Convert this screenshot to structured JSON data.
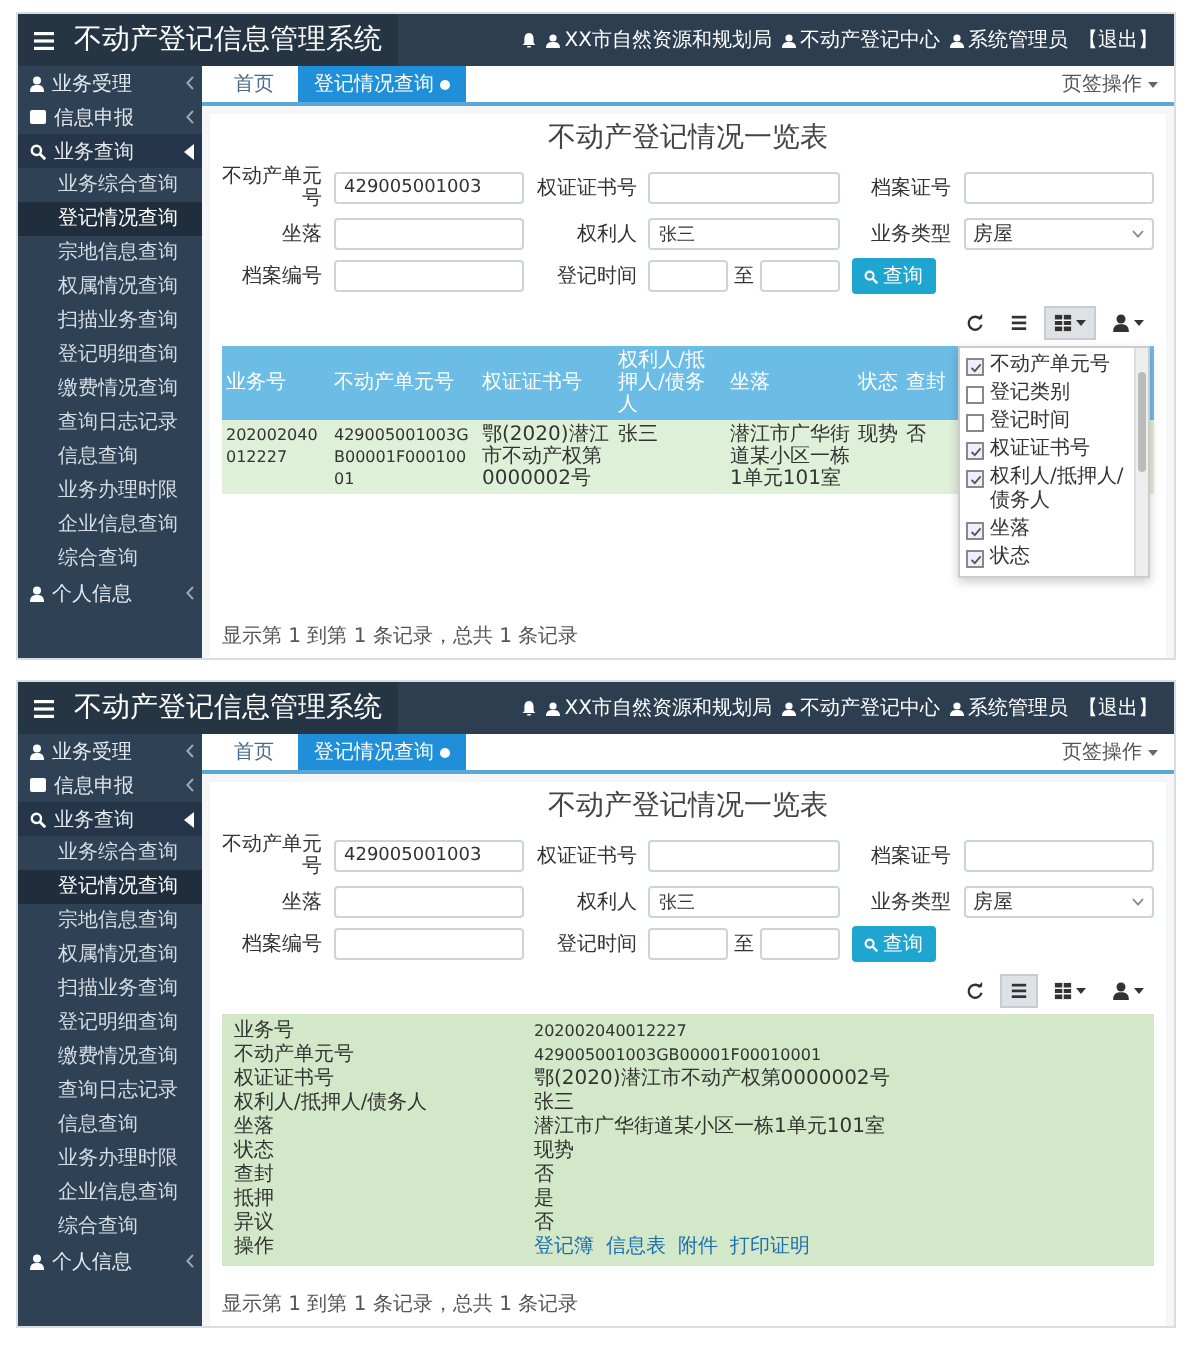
{
  "screens": [
    {
      "app_title": "不动产登记信息管理系统",
      "header_links": [
        {
          "kind": "user",
          "label": "XX市自然资源和规划局"
        },
        {
          "kind": "user",
          "label": "不动产登记中心"
        },
        {
          "kind": "user",
          "label": "系统管理员"
        },
        {
          "kind": "plain",
          "label": "【退出】"
        }
      ],
      "sidebar": [
        {
          "kind": "user",
          "label": "业务受理",
          "expanded": false
        },
        {
          "kind": "card",
          "label": "信息申报",
          "expanded": false
        },
        {
          "kind": "search",
          "label": "业务查询",
          "expanded": true,
          "children": [
            {
              "label": "业务综合查询",
              "selected": false
            },
            {
              "label": "登记情况查询",
              "selected": true
            },
            {
              "label": "宗地信息查询",
              "selected": false
            },
            {
              "label": "权属情况查询",
              "selected": false
            },
            {
              "label": "扫描业务查询",
              "selected": false
            },
            {
              "label": "登记明细查询",
              "selected": false
            },
            {
              "label": "缴费情况查询",
              "selected": false
            },
            {
              "label": "查询日志记录",
              "selected": false
            },
            {
              "label": "信息查询",
              "selected": false
            },
            {
              "label": "业务办理时限",
              "selected": false
            },
            {
              "label": "企业信息查询",
              "selected": false
            },
            {
              "label": "综合查询",
              "selected": false
            }
          ]
        },
        {
          "kind": "circle",
          "label": "个人信息",
          "expanded": false
        }
      ],
      "tabs": [
        {
          "label": "首页",
          "selected": false,
          "closable": false
        },
        {
          "label": "登记情况查询",
          "selected": true,
          "closable": true
        }
      ],
      "tab_menu": "页签操作",
      "page_title": "不动产登记情况一览表",
      "form": [
        {
          "kind": "text",
          "label": "不动产单元号",
          "value": "429005001003"
        },
        {
          "kind": "text",
          "label": "权证证书号"
        },
        {
          "kind": "text",
          "label": "档案证号"
        },
        {
          "kind": "text",
          "label": "坐落"
        },
        {
          "kind": "text",
          "label": "权利人",
          "value": "张三"
        },
        {
          "kind": "select",
          "label": "业务类型",
          "value": "房屋"
        },
        {
          "kind": "text",
          "label": "档案编号"
        },
        {
          "kind": "range",
          "label": "登记时间",
          "separator": "至"
        }
      ],
      "search_button": "查询",
      "toolbar": [
        {
          "kind": "refresh",
          "pressed": false
        },
        {
          "kind": "card",
          "pressed": false
        },
        {
          "kind": "columns",
          "pressed": true
        },
        {
          "kind": "export",
          "pressed": false
        }
      ],
      "results": {
        "kind": "table",
        "columns": [
          "业务号",
          "不动产单元号",
          "权证证书号",
          "权利人/抵押人/债务人",
          "坐落",
          "状态",
          "查封"
        ],
        "rows": [
          [
            "202002040012227",
            "429005001003GB00001F00010001",
            "鄂(2020)潜江市不动产权第0000002号",
            "张三",
            "潜江市广华街道某小区一栋1单元101室",
            "现势",
            "否"
          ]
        ]
      },
      "columns_menu": [
        {
          "label": "不动产单元号",
          "checked": true
        },
        {
          "label": "登记类别",
          "checked": false
        },
        {
          "label": "登记时间",
          "checked": false
        },
        {
          "label": "权证证书号",
          "checked": true
        },
        {
          "label": "权利人/抵押人/债务人",
          "checked": true
        },
        {
          "label": "坐落",
          "checked": true
        },
        {
          "label": "状态",
          "checked": true
        }
      ],
      "footer": "显示第 1 到第 1 条记录，总共 1 条记录"
    },
    {
      "app_title": "不动产登记信息管理系统",
      "header_links": [
        {
          "kind": "user",
          "label": "XX市自然资源和规划局"
        },
        {
          "kind": "user",
          "label": "不动产登记中心"
        },
        {
          "kind": "user",
          "label": "系统管理员"
        },
        {
          "kind": "plain",
          "label": "【退出】"
        }
      ],
      "sidebar": [
        {
          "kind": "user",
          "label": "业务受理",
          "expanded": false
        },
        {
          "kind": "card",
          "label": "信息申报",
          "expanded": false
        },
        {
          "kind": "search",
          "label": "业务查询",
          "expanded": true,
          "children": [
            {
              "label": "业务综合查询",
              "selected": false
            },
            {
              "label": "登记情况查询",
              "selected": true
            },
            {
              "label": "宗地信息查询",
              "selected": false
            },
            {
              "label": "权属情况查询",
              "selected": false
            },
            {
              "label": "扫描业务查询",
              "selected": false
            },
            {
              "label": "登记明细查询",
              "selected": false
            },
            {
              "label": "缴费情况查询",
              "selected": false
            },
            {
              "label": "查询日志记录",
              "selected": false
            },
            {
              "label": "信息查询",
              "selected": false
            },
            {
              "label": "业务办理时限",
              "selected": false
            },
            {
              "label": "企业信息查询",
              "selected": false
            },
            {
              "label": "综合查询",
              "selected": false
            }
          ]
        },
        {
          "kind": "circle",
          "label": "个人信息",
          "expanded": false
        }
      ],
      "tabs": [
        {
          "label": "首页",
          "selected": false,
          "closable": false
        },
        {
          "label": "登记情况查询",
          "selected": true,
          "closable": true
        }
      ],
      "tab_menu": "页签操作",
      "page_title": "不动产登记情况一览表",
      "form": [
        {
          "kind": "text",
          "label": "不动产单元号",
          "value": "429005001003"
        },
        {
          "kind": "text",
          "label": "权证证书号"
        },
        {
          "kind": "text",
          "label": "档案证号"
        },
        {
          "kind": "text",
          "label": "坐落"
        },
        {
          "kind": "text",
          "label": "权利人",
          "value": "张三"
        },
        {
          "kind": "select",
          "label": "业务类型",
          "value": "房屋"
        },
        {
          "kind": "text",
          "label": "档案编号"
        },
        {
          "kind": "range",
          "label": "登记时间",
          "separator": "至"
        }
      ],
      "search_button": "查询",
      "toolbar": [
        {
          "kind": "refresh",
          "pressed": false
        },
        {
          "kind": "card",
          "pressed": true
        },
        {
          "kind": "columns",
          "pressed": false
        },
        {
          "kind": "export",
          "pressed": false
        }
      ],
      "results": {
        "kind": "card",
        "fields": [
          {
            "label": "业务号",
            "value": "202002040012227"
          },
          {
            "label": "不动产单元号",
            "value": "429005001003GB00001F00010001"
          },
          {
            "label": "权证证书号",
            "value": "鄂(2020)潜江市不动产权第0000002号"
          },
          {
            "label": "权利人/抵押人/债务人",
            "value": "张三"
          },
          {
            "label": "坐落",
            "value": "潜江市广华街道某小区一栋1单元101室"
          },
          {
            "label": "状态",
            "value": "现势"
          },
          {
            "label": "查封",
            "value": "否"
          },
          {
            "label": "抵押",
            "value": "是"
          },
          {
            "label": "异议",
            "value": "否"
          }
        ],
        "actions_label": "操作",
        "actions": [
          "登记簿",
          "信息表",
          "附件",
          "打印证明"
        ]
      },
      "footer": "显示第 1 到第 1 条记录，总共 1 条记录"
    }
  ]
}
